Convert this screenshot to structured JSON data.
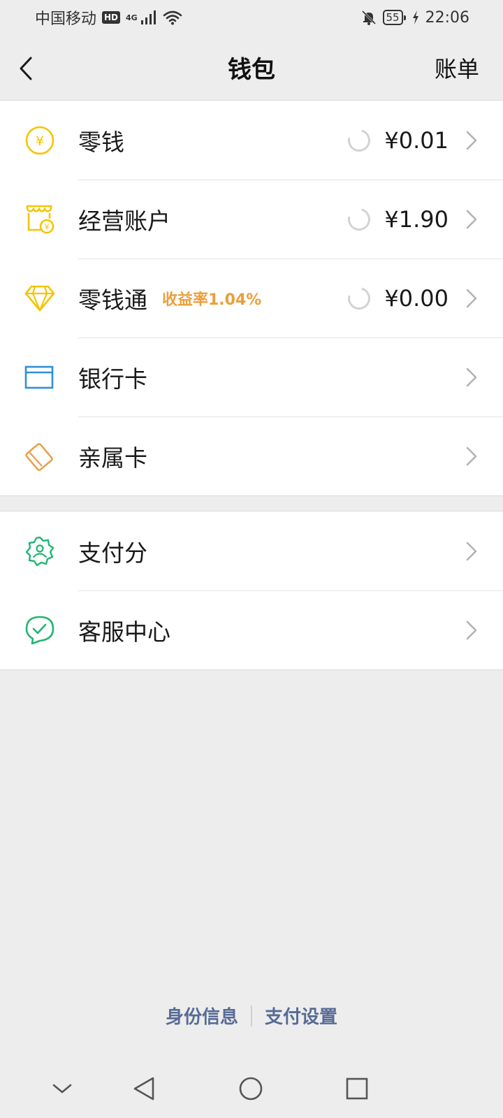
{
  "status_bar": {
    "carrier": "中国移动",
    "hd": "HD",
    "network": "4G",
    "battery": "55",
    "time": "22:06"
  },
  "header": {
    "title": "钱包",
    "right_action": "账单"
  },
  "wallet_items": [
    {
      "label": "零钱",
      "amount": "¥0.01",
      "icon": "coin-yuan-icon"
    },
    {
      "label": "经营账户",
      "amount": "¥1.90",
      "icon": "shop-account-icon"
    },
    {
      "label": "零钱通",
      "badge": "收益率1.04%",
      "amount": "¥0.00",
      "icon": "diamond-icon"
    },
    {
      "label": "银行卡",
      "icon": "bank-card-icon"
    },
    {
      "label": "亲属卡",
      "icon": "family-card-icon"
    }
  ],
  "service_items": [
    {
      "label": "支付分",
      "icon": "pay-score-badge-icon"
    },
    {
      "label": "客服中心",
      "icon": "customer-service-chat-icon"
    }
  ],
  "footer": {
    "identity_link": "身份信息",
    "settings_link": "支付设置"
  },
  "colors": {
    "background": "#ededed",
    "yellow_icon": "#f5c400",
    "blue_icon": "#2f8fd8",
    "orange_icon": "#e8a04a",
    "green_icon": "#21b573",
    "rate_badge": "#eb9f3a",
    "footer_link": "#576b95"
  }
}
